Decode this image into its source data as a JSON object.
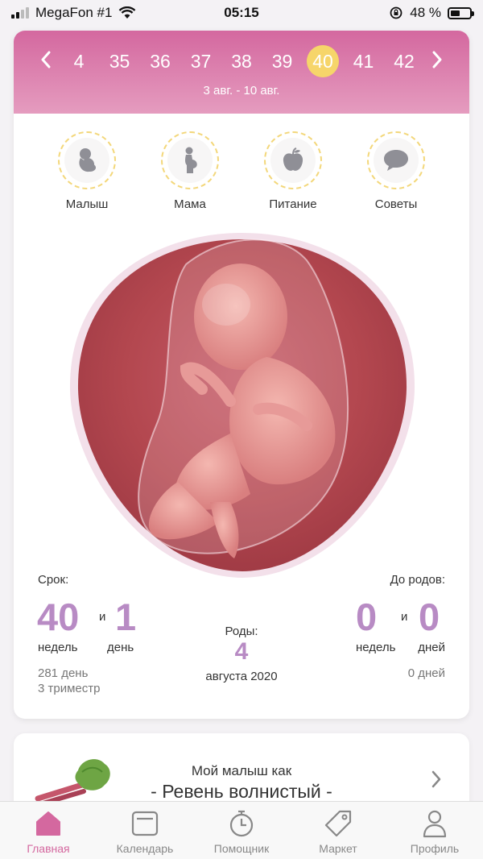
{
  "status_bar": {
    "carrier": "MegaFon #1",
    "time": "05:15",
    "battery_text": "48 %"
  },
  "week_selector": {
    "prev_icon": "chevron-left-icon",
    "next_icon": "chevron-right-icon",
    "weeks": [
      "4",
      "35",
      "36",
      "37",
      "38",
      "39",
      "40",
      "41",
      "42"
    ],
    "active_week": "40",
    "date_range": "3 авг. - 10 авг."
  },
  "sections": [
    {
      "label": "Малыш",
      "icon": "baby-icon"
    },
    {
      "label": "Мама",
      "icon": "pregnant-woman-icon"
    },
    {
      "label": "Питание",
      "icon": "apple-icon"
    },
    {
      "label": "Советы",
      "icon": "chat-bubble-icon"
    }
  ],
  "image": {
    "name": "fetus-illustration"
  },
  "term": {
    "label": "Срок:",
    "weeks_value": "40",
    "and": "и",
    "days_value": "1",
    "weeks_unit": "недель",
    "days_unit": "день",
    "total_days": "281 день",
    "trimester": "3 триместр"
  },
  "birth": {
    "label": "Роды:",
    "day": "4",
    "month_year": "августа 2020"
  },
  "until_birth": {
    "label": "До родов:",
    "weeks_value": "0",
    "and": "и",
    "days_value": "0",
    "weeks_unit": "недель",
    "days_unit": "дней",
    "total_days": "0 дней"
  },
  "size_card": {
    "intro": "Мой малыш как",
    "title": "- Ревень волнистый -",
    "icon": "rhubarb-icon"
  },
  "tabs": [
    {
      "label": "Главная",
      "icon": "home-icon",
      "active": true
    },
    {
      "label": "Календарь",
      "icon": "calendar-icon",
      "active": false
    },
    {
      "label": "Помощник",
      "icon": "stopwatch-icon",
      "active": false
    },
    {
      "label": "Маркет",
      "icon": "tag-icon",
      "active": false
    },
    {
      "label": "Профиль",
      "icon": "profile-icon",
      "active": false
    }
  ],
  "colors": {
    "header_top": "#d4689f",
    "header_bottom": "#e59cbf",
    "accent_purple": "#b88bc4",
    "active_week_bg": "#f6d56a",
    "active_tab": "#d4689f"
  }
}
